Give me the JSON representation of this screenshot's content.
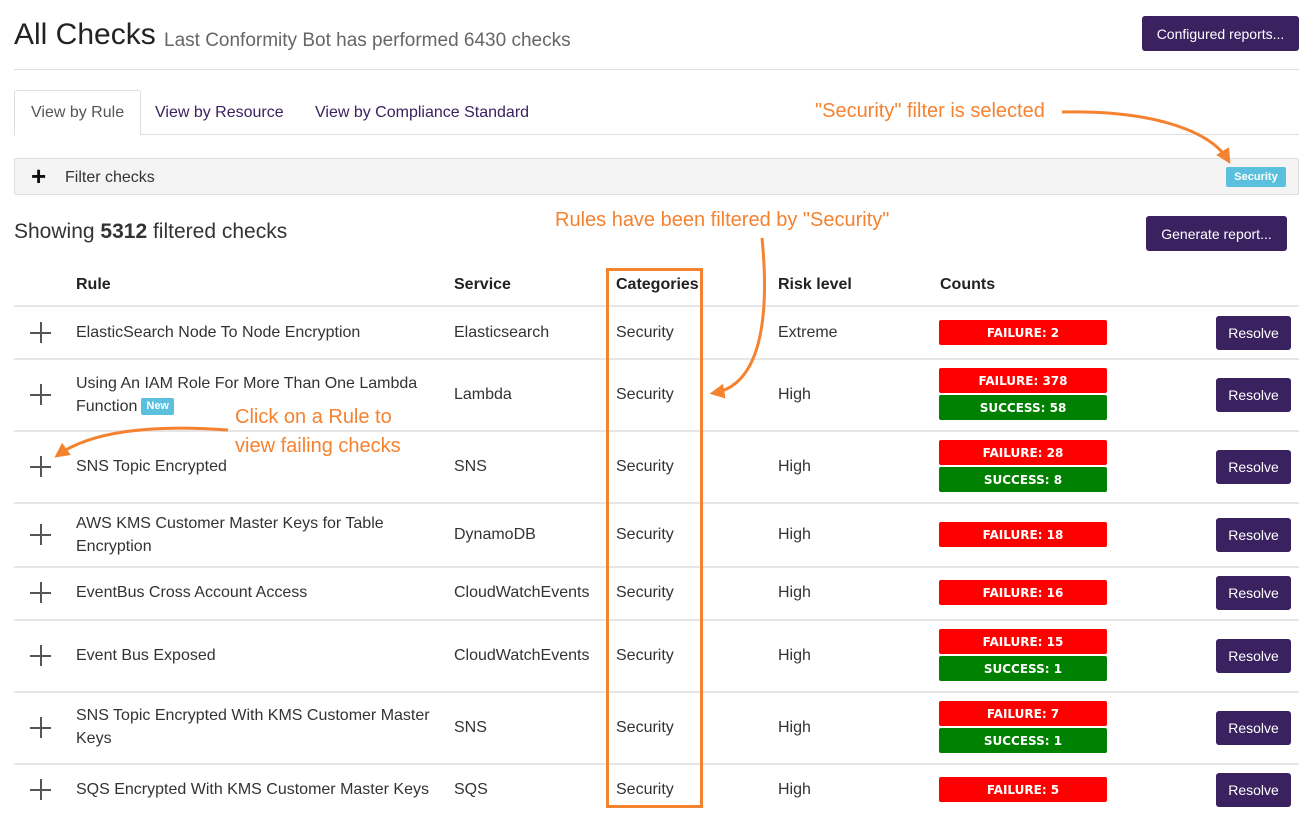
{
  "header": {
    "title": "All Checks",
    "subtitle": "Last Conformity Bot has performed 6430 checks",
    "configured_reports_label": "Configured reports..."
  },
  "tabs": [
    {
      "label": "View by Rule",
      "active": true
    },
    {
      "label": "View by Resource",
      "active": false
    },
    {
      "label": "View by Compliance Standard",
      "active": false
    }
  ],
  "filter": {
    "label": "Filter checks",
    "active_tag": "Security"
  },
  "summary": {
    "prefix": "Showing",
    "count": "5312",
    "suffix": "filtered checks",
    "generate_report_label": "Generate report..."
  },
  "columns": {
    "rule": "Rule",
    "service": "Service",
    "categories": "Categories",
    "risk": "Risk level",
    "counts": "Counts"
  },
  "rows": [
    {
      "rule": "ElasticSearch Node To Node Encryption",
      "service": "Elasticsearch",
      "category": "Security",
      "risk": "Extreme",
      "failure": "FAILURE: 2",
      "success": "",
      "resolve": "Resolve"
    },
    {
      "rule": "Using An IAM Role For More Than One Lambda Function",
      "badge": "New",
      "service": "Lambda",
      "category": "Security",
      "risk": "High",
      "failure": "FAILURE: 378",
      "success": "SUCCESS: 58",
      "resolve": "Resolve"
    },
    {
      "rule": "SNS Topic Encrypted",
      "service": "SNS",
      "category": "Security",
      "risk": "High",
      "failure": "FAILURE: 28",
      "success": "SUCCESS: 8",
      "resolve": "Resolve"
    },
    {
      "rule": "AWS KMS Customer Master Keys for Table Encryption",
      "service": "DynamoDB",
      "category": "Security",
      "risk": "High",
      "failure": "FAILURE: 18",
      "success": "",
      "resolve": "Resolve"
    },
    {
      "rule": "EventBus Cross Account Access",
      "service": "CloudWatchEvents",
      "category": "Security",
      "risk": "High",
      "failure": "FAILURE: 16",
      "success": "",
      "resolve": "Resolve"
    },
    {
      "rule": "Event Bus Exposed",
      "service": "CloudWatchEvents",
      "category": "Security",
      "risk": "High",
      "failure": "FAILURE: 15",
      "success": "SUCCESS: 1",
      "resolve": "Resolve"
    },
    {
      "rule": "SNS Topic Encrypted With KMS Customer Master Keys",
      "service": "SNS",
      "category": "Security",
      "risk": "High",
      "failure": "FAILURE: 7",
      "success": "SUCCESS: 1",
      "resolve": "Resolve"
    },
    {
      "rule": "SQS Encrypted With KMS Customer Master Keys",
      "service": "SQS",
      "category": "Security",
      "risk": "High",
      "failure": "FAILURE: 5",
      "success": "",
      "resolve": "Resolve"
    }
  ],
  "annotations": {
    "filter_selected": "\"Security\" filter is selected",
    "rules_filtered": "Rules have been filtered by \"Security\"",
    "click_rule_line1": "Click on a Rule to",
    "click_rule_line2": "view failing checks"
  },
  "colors": {
    "brand": "#3a2160",
    "failure": "#ff0000",
    "success": "#008000",
    "annotation": "#f5822f",
    "tag": "#5bc0de"
  }
}
